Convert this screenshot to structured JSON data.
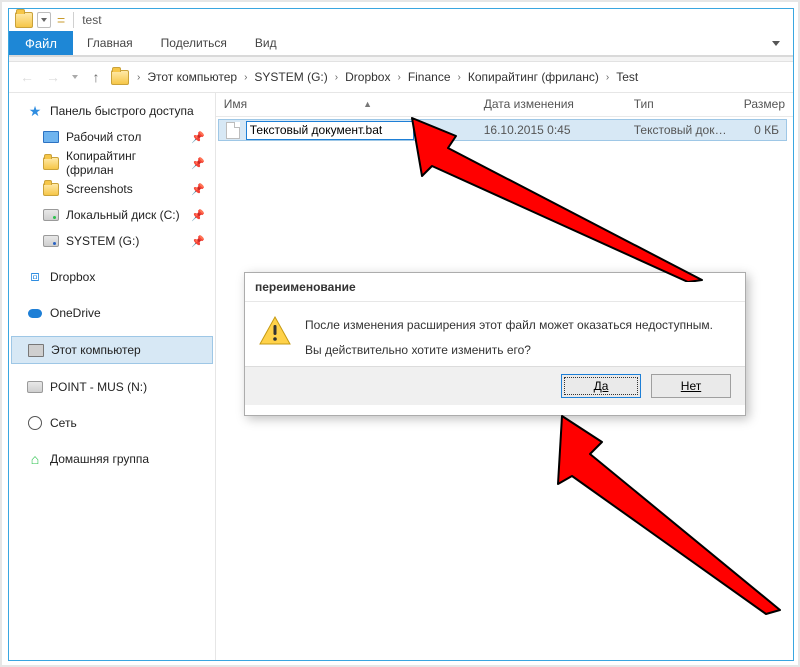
{
  "title": "test",
  "ribbon": {
    "file": "Файл",
    "home": "Главная",
    "share": "Поделиться",
    "view": "Вид"
  },
  "breadcrumb": {
    "labels": [
      "Этот компьютер",
      "SYSTEM (G:)",
      "Dropbox",
      "Finance",
      "Копирайтинг (фриланс)",
      "Test"
    ]
  },
  "nav": {
    "quick_access": "Панель быстрого доступа",
    "desktop": "Рабочий стол",
    "copywriting": "Копирайтинг (фрилан",
    "screenshots": "Screenshots",
    "local_c": "Локальный диск (C:)",
    "system_g": "SYSTEM (G:)",
    "dropbox": "Dropbox",
    "onedrive": "OneDrive",
    "this_pc": "Этот компьютер",
    "point_mus": "POINT - MUS (N:)",
    "network": "Сеть",
    "homegroup": "Домашняя группа"
  },
  "columns": {
    "name": "Имя",
    "date": "Дата изменения",
    "type": "Тип",
    "size": "Размер"
  },
  "file": {
    "rename_value": "Текстовый документ.bat",
    "date": "16.10.2015 0:45",
    "type": "Текстовый доку…",
    "size": "0 КБ"
  },
  "dialog": {
    "title": "переименование",
    "line1": "После изменения расширения этот файл может оказаться недоступным.",
    "line2": "Вы действительно хотите изменить его?",
    "yes": "Да",
    "no": "Нет"
  }
}
